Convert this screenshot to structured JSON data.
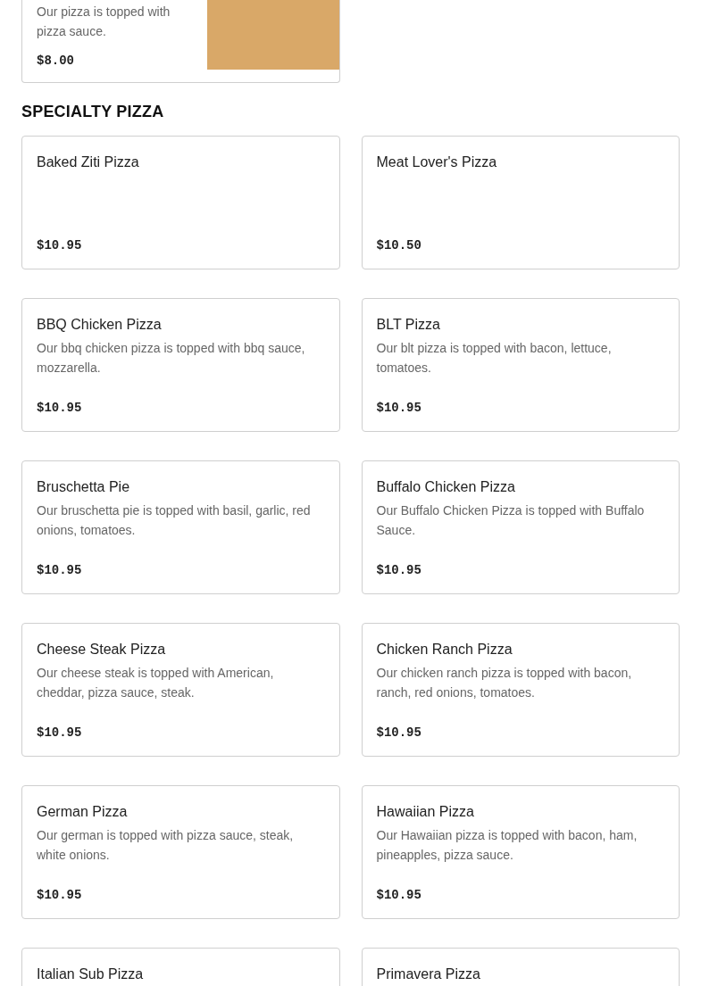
{
  "top_item": {
    "description": "Our pizza is topped with pizza sauce.",
    "price": "$8.00"
  },
  "section": {
    "title": "SPECIALTY PIZZA",
    "items": [
      {
        "name": "Baked Ziti Pizza",
        "price": "$10.95"
      },
      {
        "name": "Meat Lover's Pizza",
        "price": "$10.50"
      },
      {
        "name": "BBQ Chicken Pizza",
        "description": "Our bbq chicken pizza is topped with bbq sauce, mozzarella.",
        "price": "$10.95"
      },
      {
        "name": "BLT Pizza",
        "description": "Our blt pizza is topped with bacon, lettuce, tomatoes.",
        "price": "$10.95"
      },
      {
        "name": "Bruschetta Pie",
        "description": "Our bruschetta pie is topped with basil, garlic, red onions, tomatoes.",
        "price": "$10.95"
      },
      {
        "name": "Buffalo Chicken Pizza",
        "description": "Our Buffalo Chicken Pizza is topped with Buffalo Sauce.",
        "price": "$10.95"
      },
      {
        "name": "Cheese Steak Pizza",
        "description": "Our cheese steak is topped with American, cheddar, pizza sauce, steak.",
        "price": "$10.95"
      },
      {
        "name": "Chicken Ranch Pizza",
        "description": "Our chicken ranch pizza is topped with bacon, ranch, red onions, tomatoes.",
        "price": "$10.95"
      },
      {
        "name": "German Pizza",
        "description": "Our german is topped with pizza sauce, steak, white onions.",
        "price": "$10.95"
      },
      {
        "name": "Hawaiian Pizza",
        "description": "Our Hawaiian pizza is topped with bacon, ham, pineapples, pizza sauce.",
        "price": "$10.95"
      },
      {
        "name": "Italian Sub Pizza"
      },
      {
        "name": "Primavera Pizza"
      }
    ]
  }
}
